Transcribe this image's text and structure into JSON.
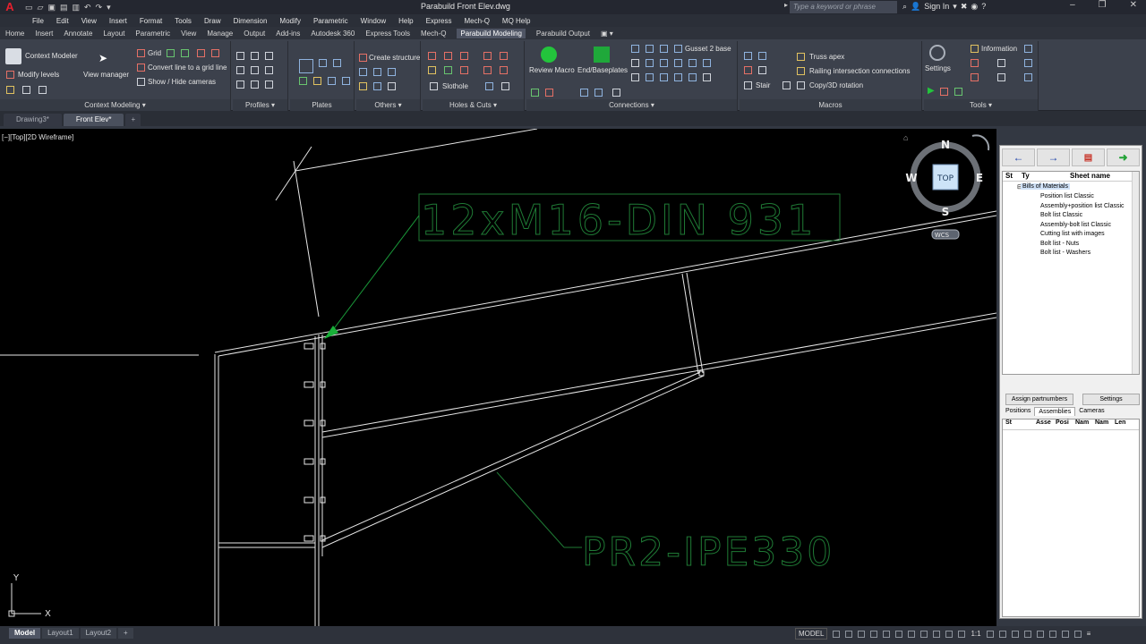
{
  "app": {
    "logo": "A",
    "title": "Parabuild   Front Elev.dwg",
    "search_placeholder": "Type a keyword or phrase",
    "sign_in": "Sign In"
  },
  "menu": [
    "File",
    "Edit",
    "View",
    "Insert",
    "Format",
    "Tools",
    "Draw",
    "Dimension",
    "Modify",
    "Parametric",
    "Window",
    "Help",
    "Express",
    "Mech-Q",
    "MQ Help"
  ],
  "ribbon_tabs": [
    "Home",
    "Insert",
    "Annotate",
    "Layout",
    "Parametric",
    "View",
    "Manage",
    "Output",
    "Add-ins",
    "Autodesk 360",
    "Express Tools",
    "Mech-Q",
    "Parabuild Modeling",
    "Parabuild Output"
  ],
  "ribbon_active_tab": "Parabuild Modeling",
  "ribbon": {
    "context_modeler": "Context Modeler",
    "modify_levels": "Modify levels",
    "view_manager": "View manager",
    "grid": "Grid",
    "convert_line": "Convert line to a grid line",
    "show_hide_cameras": "Show / Hide cameras",
    "create_structure": "Create structure",
    "slothole": "Slothole",
    "review_macro": "Review Macro",
    "end_baseplates": "End/Baseplates",
    "gusset_base": "Gusset 2 base",
    "truss_apex": "Truss apex",
    "railing": "Railing intersection connections",
    "stair": "Stair",
    "copy_rotation": "Copy/3D rotation",
    "settings": "Settings",
    "information": "Information",
    "panels": [
      "Context Modeling",
      "Profiles",
      "Plates",
      "Others",
      "Holes & Cuts",
      "Connections",
      "Macros",
      "Tools"
    ]
  },
  "doc_tabs": [
    "Drawing3*",
    "Front Elev*"
  ],
  "active_doc_tab": "Front Elev*",
  "canvas": {
    "view_label": "[−][Top][2D Wireframe]",
    "label_bolts": "12xM16-DIN 931",
    "label_profile": "PR2-IPE330",
    "ucs_x": "X",
    "ucs_y": "Y"
  },
  "viewcube": {
    "n": "N",
    "s": "S",
    "e": "E",
    "w": "W",
    "top": "TOP",
    "wcs": "WCS"
  },
  "side_panel": {
    "tree_headers": [
      "St",
      "Ty",
      "Sheet name"
    ],
    "tree_root": "Bills of Materials",
    "tree_items": [
      "Position list Classic",
      "Assembly+position list Classic",
      "Bolt list Classic",
      "Assembly-bolt list Classic",
      "Cutting list with images",
      "Bolt list - Nuts",
      "Bolt list - Washers"
    ],
    "assign_partnumbers": "Assign partnumbers",
    "settings": "Settings",
    "tabs": [
      "Positions",
      "Assemblies",
      "Cameras"
    ],
    "active_tab": "Assemblies",
    "grid_headers": [
      "St",
      "Asse",
      "Posi",
      "Nam",
      "Nam",
      "Len"
    ]
  },
  "bottom_tabs": [
    "Model",
    "Layout1",
    "Layout2"
  ],
  "active_bottom_tab": "Model",
  "status": {
    "model": "MODEL",
    "scale": "1:1"
  },
  "colors": {
    "canvas_bg": "#000000",
    "linework": "#e6e6e6",
    "annotation_green": "#1f7a35",
    "leader_arrow": "#19b039"
  }
}
